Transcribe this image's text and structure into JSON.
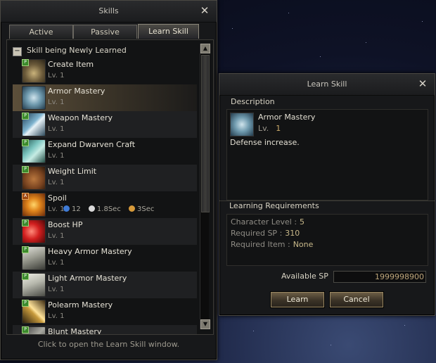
{
  "skills_window": {
    "title": "Skills",
    "tabs": [
      {
        "label": "Active"
      },
      {
        "label": "Passive"
      },
      {
        "label": "Learn Skill"
      }
    ],
    "group_label": "Skill being Newly Learned",
    "skills": [
      {
        "name": "Create Item",
        "level": "Lv. 1"
      },
      {
        "name": "Armor Mastery",
        "level": "Lv. 1"
      },
      {
        "name": "Weapon Mastery",
        "level": "Lv. 1"
      },
      {
        "name": "Expand Dwarven Craft",
        "level": "Lv. 1"
      },
      {
        "name": "Weight Limit",
        "level": "Lv. 1"
      },
      {
        "name": "Spoil",
        "level": "Lv. 1",
        "mp": "12",
        "cast": "1.8Sec",
        "reuse": "3Sec"
      },
      {
        "name": "Boost HP",
        "level": "Lv. 1"
      },
      {
        "name": "Heavy Armor Mastery",
        "level": "Lv. 1"
      },
      {
        "name": "Light Armor Mastery",
        "level": "Lv. 1"
      },
      {
        "name": "Polearm Mastery",
        "level": "Lv. 1"
      },
      {
        "name": "Blunt Mastery",
        "level": ""
      }
    ],
    "hint": "Click to open the Learn Skill window."
  },
  "learn_window": {
    "title": "Learn Skill",
    "description_label": "Description",
    "skill_name": "Armor Mastery",
    "level_label": "Lv.",
    "level_value": "1",
    "description": "Defense increase.",
    "requirements_label": "Learning Requirements",
    "requirements": [
      {
        "label": "Character Level",
        "value": "5"
      },
      {
        "label": "Required SP",
        "value": "310"
      },
      {
        "label": "Required Item",
        "value": "None"
      }
    ],
    "available_sp_label": "Available SP",
    "available_sp": "1999998900",
    "learn_button": "Learn",
    "cancel_button": "Cancel"
  },
  "icons": [
    "close-icon",
    "collapse-icon",
    "scroll-up-icon",
    "scroll-down-icon",
    "mp-icon",
    "cast-time-icon",
    "reuse-time-icon"
  ]
}
